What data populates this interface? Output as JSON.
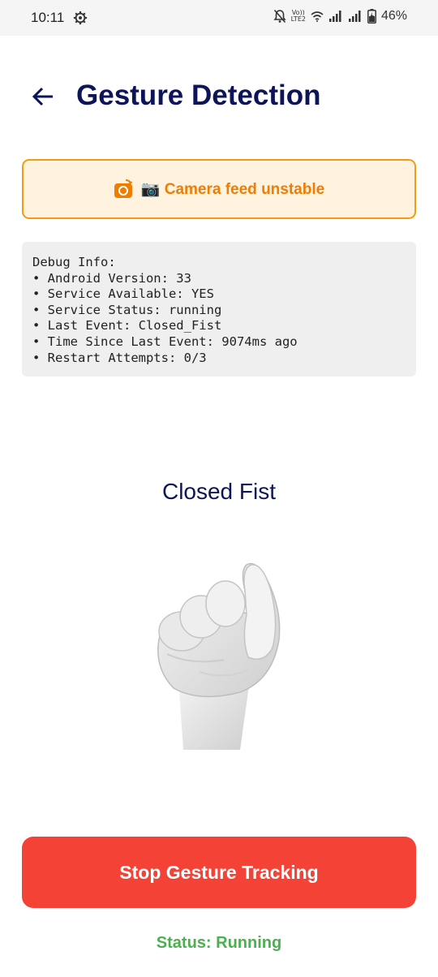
{
  "status_bar": {
    "time": "10:11",
    "volte_top": "Vo))",
    "volte_bottom": "LTE2",
    "battery": "46%"
  },
  "header": {
    "title": "Gesture Detection"
  },
  "warning": {
    "text": "📷 Camera feed unstable",
    "color": "#ef7d00",
    "border_color": "#f39c12"
  },
  "debug": {
    "lines": [
      "Debug Info:",
      "• Android Version: 33",
      "• Service Available: YES",
      "• Service Status: running",
      "• Last Event: Closed_Fist",
      "• Time Since Last Event: 9074ms ago",
      "• Restart Attempts: 0/3"
    ]
  },
  "gesture": {
    "name": "Closed Fist",
    "icon": "closed-fist-image"
  },
  "actions": {
    "stop_label": "Stop Gesture Tracking",
    "stop_color": "#f44336"
  },
  "status": {
    "text": "Status: Running",
    "color": "#4caf50"
  }
}
